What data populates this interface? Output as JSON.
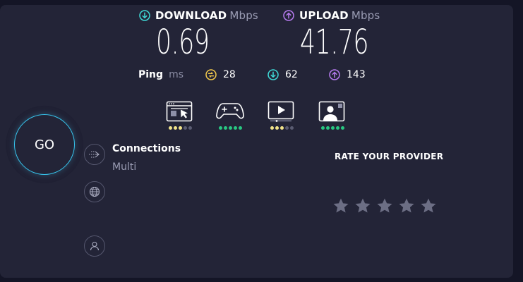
{
  "download": {
    "label": "DOWNLOAD",
    "unit": "Mbps",
    "value": "0.69"
  },
  "upload": {
    "label": "UPLOAD",
    "unit": "Mbps",
    "value": "41.76"
  },
  "ping": {
    "label": "Ping",
    "unit": "ms",
    "idle": "28",
    "down": "62",
    "up": "143"
  },
  "activities": [
    {
      "icon": "browsing-icon",
      "dots_active": 3,
      "dot_color": "#f2e48a"
    },
    {
      "icon": "gaming-icon",
      "dots_active": 5,
      "dot_color": "#28c781"
    },
    {
      "icon": "streaming-icon",
      "dots_active": 3,
      "dot_color": "#f2e48a"
    },
    {
      "icon": "video-call-icon",
      "dots_active": 5,
      "dot_color": "#28c781"
    }
  ],
  "go_label": "GO",
  "connections": {
    "title": "Connections",
    "value": "Multi"
  },
  "rate": {
    "label": "RATE YOUR PROVIDER",
    "stars": 5
  },
  "colors": {
    "download": "#3fd9d6",
    "upload": "#b77bf0",
    "ping": "#f2c94c",
    "go": "#37c5ee"
  }
}
